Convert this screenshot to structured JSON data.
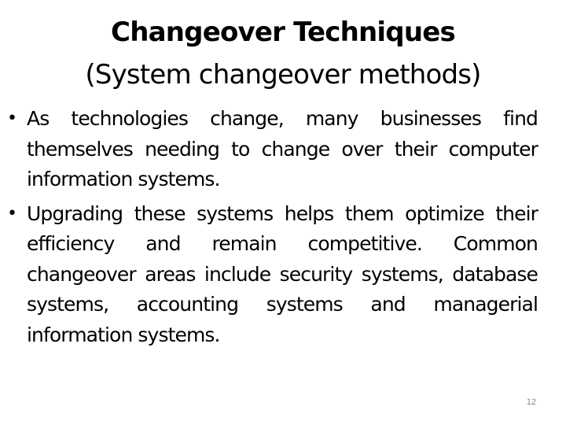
{
  "slide": {
    "title_line1": "Changeover Techniques",
    "title_line2": "(System changeover methods)",
    "bullets": [
      {
        "icon": "bullet-dot",
        "glyph": "•",
        "text": "As technologies change, many businesses find themselves needing to change over their computer information systems."
      },
      {
        "icon": "bullet-dot",
        "glyph": "•",
        "text": "Upgrading these systems helps them optimize their efficiency and remain competitive. Common changeover areas include security systems, database systems, accounting systems and managerial information systems."
      }
    ],
    "page_number": "12"
  }
}
